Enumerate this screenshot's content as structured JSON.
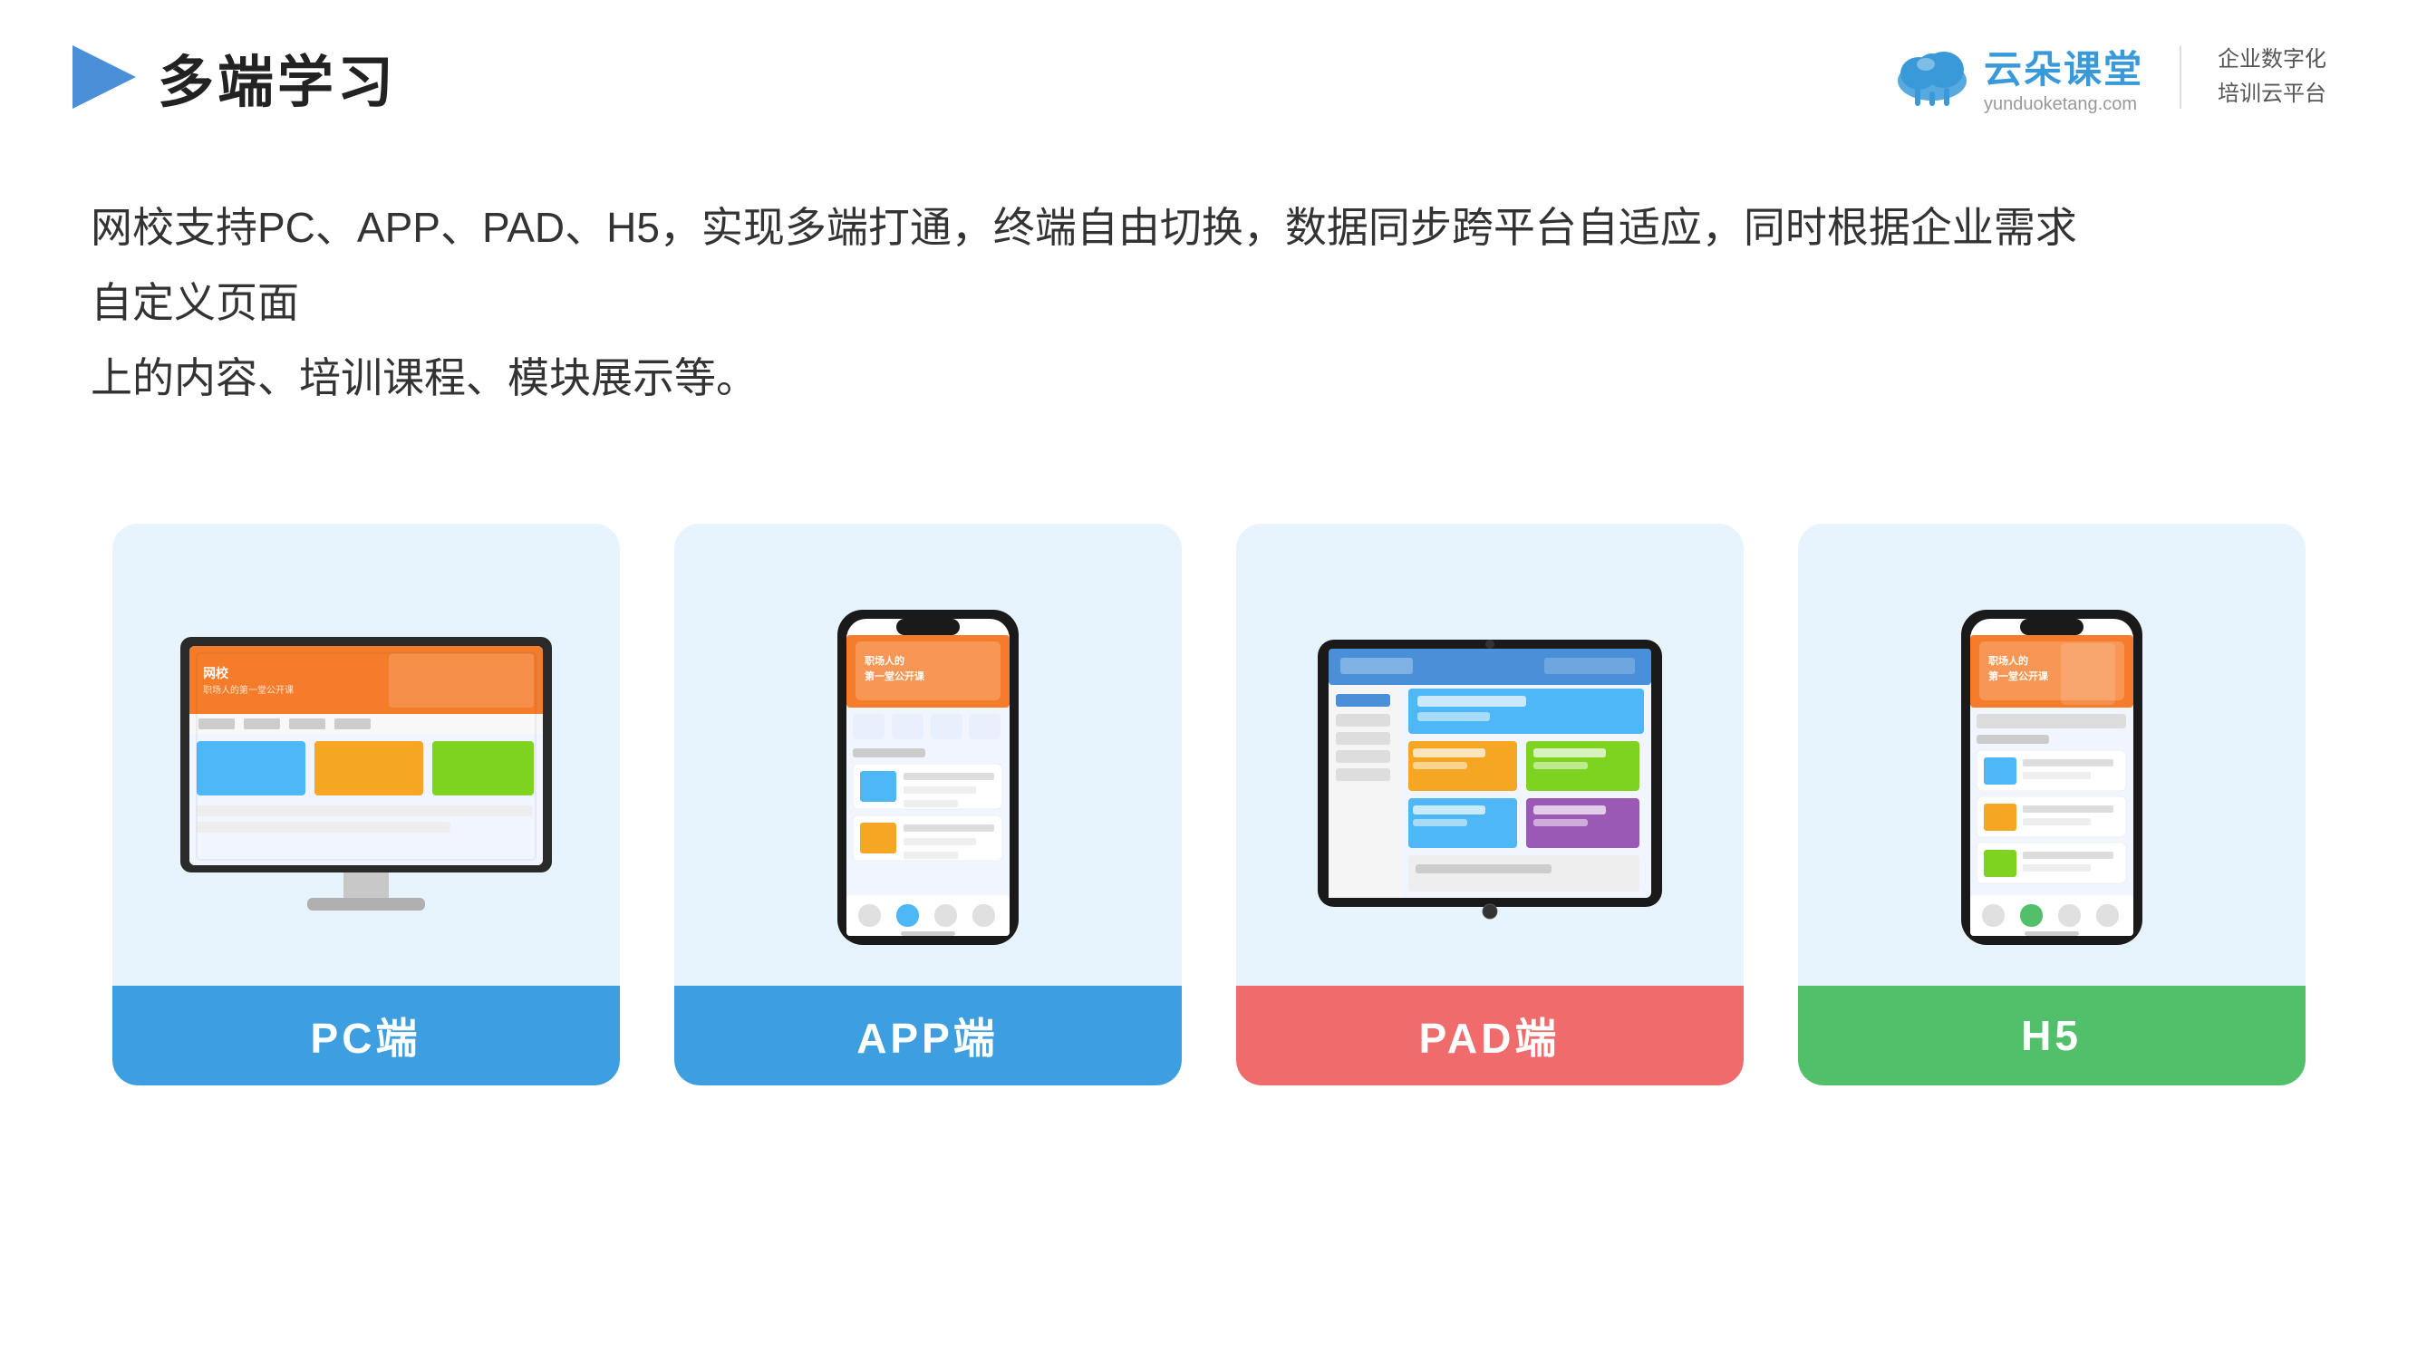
{
  "header": {
    "title": "多端学习",
    "logo": {
      "name": "云朵课堂",
      "url": "yunduoketang.com",
      "slogan_line1": "企业数字化",
      "slogan_line2": "培训云平台"
    }
  },
  "description": {
    "text_line1": "网校支持PC、APP、PAD、H5，实现多端打通，终端自由切换，数据同步跨平台自适应，同时根据企业需求自定义页面",
    "text_line2": "上的内容、培训课程、模块展示等。"
  },
  "cards": [
    {
      "id": "pc",
      "label": "PC端",
      "label_color": "blue",
      "device_type": "monitor"
    },
    {
      "id": "app",
      "label": "APP端",
      "label_color": "blue-app",
      "device_type": "phone"
    },
    {
      "id": "pad",
      "label": "PAD端",
      "label_color": "red",
      "device_type": "tablet"
    },
    {
      "id": "h5",
      "label": "H5",
      "label_color": "green",
      "device_type": "phone2"
    }
  ],
  "colors": {
    "blue": "#3d9fe0",
    "red": "#f06b6b",
    "green": "#52c06a",
    "card_bg": "#e8f4fd",
    "text_dark": "#333333",
    "title_color": "#222222"
  }
}
